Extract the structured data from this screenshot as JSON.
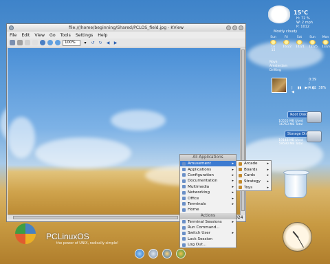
{
  "window": {
    "title": "file:///home/beginning/Shared/PCLOS_field.jpg - KView",
    "menus": [
      "File",
      "Edit",
      "View",
      "Go",
      "Tools",
      "Settings",
      "Help"
    ],
    "zoom": "100%",
    "status_number": "024"
  },
  "weather": {
    "temp": "15°C",
    "humidity_lines": [
      "H: 72 %",
      "W: 2 mph",
      "P: 1012"
    ],
    "condition": "Mostly cloudy",
    "days": [
      {
        "name": "Sun",
        "temp": "Lo 15"
      },
      {
        "name": "Fri",
        "temp": "16/22"
      },
      {
        "name": "Sat",
        "temp": "14/21"
      },
      {
        "name": "Sun",
        "temp": "12/25"
      },
      {
        "name": "Mon",
        "temp": "13/27"
      }
    ],
    "location_lines": [
      "Noya",
      "Amsterdam",
      "Drifting"
    ]
  },
  "player": {
    "time": "0:39 / 4:11",
    "volume": "38%"
  },
  "disks": [
    {
      "label": "Root Disk",
      "line1": "10555 MB Used",
      "line2": "16763 MB Total"
    },
    {
      "label": "Storage Disk",
      "line1": "19148 MB Used",
      "line2": "59590 MB Total"
    }
  ],
  "branding": {
    "name": "PCLinuxOS",
    "tagline": "the power of UNIX, radically simple!"
  },
  "app_menu": {
    "header": "All Applications",
    "items": [
      {
        "label": "Amusement",
        "submenu": true
      },
      {
        "label": "Applications",
        "submenu": true
      },
      {
        "label": "Configuration",
        "submenu": true
      },
      {
        "label": "Documentation",
        "submenu": true
      },
      {
        "label": "Multimedia",
        "submenu": true
      },
      {
        "label": "Networking",
        "submenu": true
      },
      {
        "label": "Office",
        "submenu": true
      },
      {
        "label": "Terminals",
        "submenu": true
      },
      {
        "label": "Home",
        "submenu": false
      }
    ],
    "actions_header": "Actions",
    "actions": [
      {
        "label": "Terminal Sessions",
        "submenu": true
      },
      {
        "label": "Run Command...",
        "submenu": false
      },
      {
        "label": "Switch User",
        "submenu": true
      },
      {
        "label": "Lock Session",
        "submenu": false
      },
      {
        "label": "Log Out...",
        "submenu": false
      }
    ]
  },
  "amusement_submenu": [
    {
      "label": "Arcade",
      "submenu": true
    },
    {
      "label": "Boards",
      "submenu": true
    },
    {
      "label": "Cards",
      "submenu": true
    },
    {
      "label": "Strategy",
      "submenu": true
    },
    {
      "label": "Toys",
      "submenu": true
    }
  ],
  "colors": {
    "selection": "#3d7bd1"
  }
}
